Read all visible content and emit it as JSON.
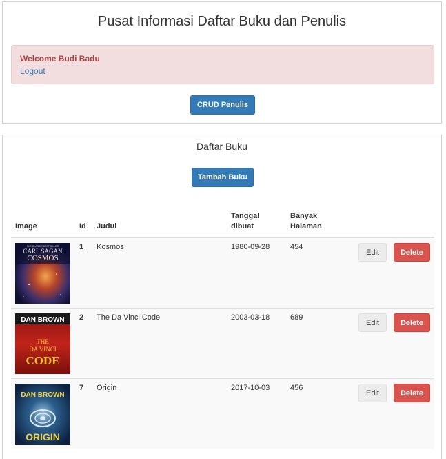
{
  "header": {
    "title": "Pusat Informasi Daftar Buku dan Penulis",
    "welcome": "Welcome Budi Badu",
    "logout": "Logout",
    "crud_button": "CRUD Penulis"
  },
  "books": {
    "title": "Daftar Buku",
    "add_button": "Tambah Buku",
    "columns": {
      "image": "Image",
      "id": "Id",
      "title": "Judul",
      "date_line1": "Tanggal",
      "date_line2": "dibuat",
      "pages_line1": "Banyak",
      "pages_line2": "Halaman"
    },
    "edit_label": "Edit",
    "delete_label": "Delete",
    "rows": [
      {
        "id": "1",
        "title": "Kosmos",
        "date": "1980-09-28",
        "pages": "454",
        "cover": {
          "top": "THE CLASSIC BESTSELLER",
          "author": "CARL SAGAN",
          "book": "COSMOS"
        }
      },
      {
        "id": "2",
        "title": "The Da Vinci Code",
        "date": "2003-03-18",
        "pages": "689",
        "cover": {
          "author": "DAN BROWN",
          "book1": "THE",
          "book2": "DA VINCI",
          "book3": "CODE"
        }
      },
      {
        "id": "7",
        "title": "Origin",
        "date": "2017-10-03",
        "pages": "456",
        "cover": {
          "author": "DAN BROWN",
          "book": "ORIGIN"
        }
      }
    ]
  }
}
